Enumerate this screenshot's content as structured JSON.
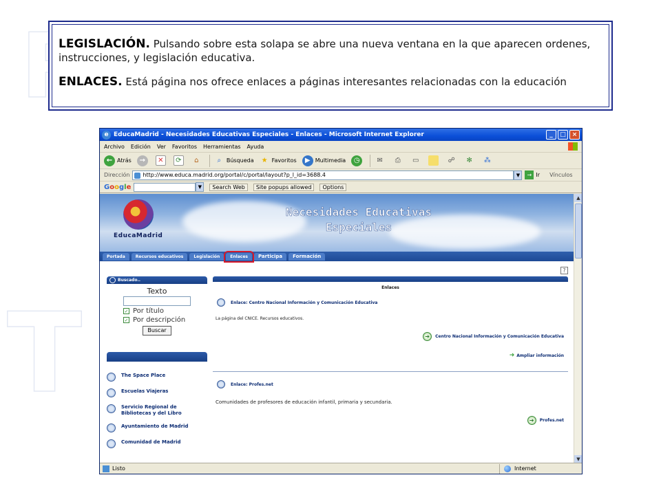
{
  "caption": {
    "legislacion_heading": "LEGISLACIÓN.",
    "legislacion_text": "Pulsando sobre esta solapa se abre una nueva ventana en la que aparecen ordenes, instrucciones,  y legislación educativa.",
    "enlaces_heading": "ENLACES.",
    "enlaces_text": "Está página nos ofrece enlaces a páginas interesantes relacionadas con la educación"
  },
  "window": {
    "title": "EducaMadrid - Necesidades Educativas Especiales - Enlaces - Microsoft Internet Explorer",
    "minimize": "_",
    "maximize": "□",
    "close": "×"
  },
  "menu": [
    "Archivo",
    "Edición",
    "Ver",
    "Favoritos",
    "Herramientas",
    "Ayuda"
  ],
  "toolbar": {
    "back": "Atrás",
    "search": "Búsqueda",
    "favorites": "Favoritos",
    "multimedia": "Multimedia"
  },
  "address": {
    "label": "Dirección",
    "url": "http://www.educa.madrid.org/portal/c/portal/layout?p_l_id=3688.4",
    "go": "Ir",
    "links": "Vínculos"
  },
  "google": {
    "search_web": "Search Web",
    "popups": "Site popups allowed",
    "options": "Options"
  },
  "site": {
    "logo_text": "EducaMadrid",
    "title_line1": "Necesidades Educativas",
    "title_line2": "Especiales",
    "nav": [
      "Portada",
      "Recursos educativos",
      "Legislación",
      "Enlaces",
      "Participa",
      "Formación"
    ],
    "search_panel": "Buscado..",
    "search_label": "Texto",
    "opt_title": "Por título",
    "opt_desc": "Por descripción",
    "search_button": "Buscar",
    "side_links": [
      "The Space Place",
      "Escuelas Viajeras",
      "Servicio Regional de Bibliotecas y del Libro",
      "Ayuntamiento de Madrid",
      "Comunidad de Madrid"
    ],
    "help": "?",
    "main_title": "Enlaces",
    "entry1": {
      "title": "Enlace: Centro Nacional Información y Comunicación Educativa",
      "desc": "La página del CNICE. Recursos educativos.",
      "link": "Centro Nacional Información y Comunicación Educativa",
      "more": "Ampliar información"
    },
    "entry2": {
      "title": "Enlace: Profes.net",
      "desc": "Comunidades de profesores de educación infantil, primaria y secundaria.",
      "link": "Profes.net"
    }
  },
  "status": {
    "text": "Listo",
    "zone": "Internet"
  }
}
